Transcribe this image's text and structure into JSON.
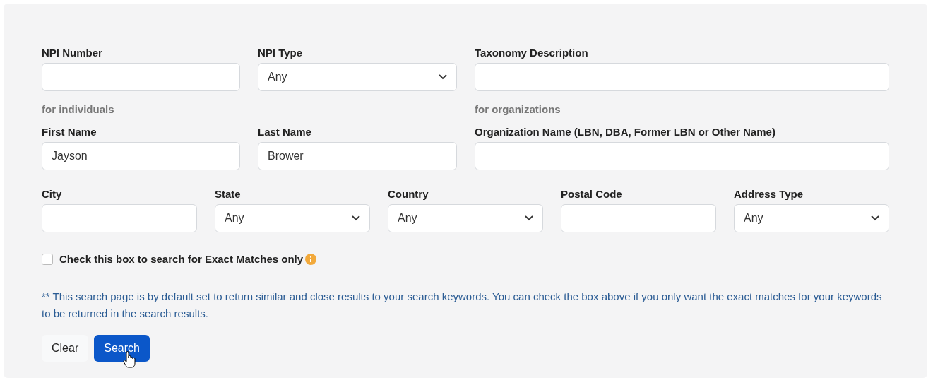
{
  "rows": [
    {
      "fields": [
        {
          "kind": "text",
          "label": "NPI Number"
        },
        {
          "kind": "select",
          "label": "NPI Type",
          "value": "Any"
        },
        {
          "kind": "text",
          "label": "Taxonomy Description"
        }
      ]
    },
    {
      "fields": [
        {
          "kind": "text",
          "caption": "for individuals",
          "label": "First Name",
          "value": "Jayson"
        },
        {
          "kind": "text",
          "label": "Last Name",
          "value": "Brower"
        },
        {
          "kind": "text",
          "caption": "for organizations",
          "label": "Organization Name (LBN, DBA, Former LBN or Other Name)"
        }
      ]
    },
    {
      "fields": [
        {
          "kind": "text",
          "label": "City"
        },
        {
          "kind": "select",
          "label": "State",
          "value": "Any"
        },
        {
          "kind": "select",
          "label": "Country",
          "value": "Any"
        },
        {
          "kind": "text",
          "label": "Postal Code"
        },
        {
          "kind": "select",
          "label": "Address Type",
          "value": "Any"
        }
      ]
    }
  ],
  "exact_match": {
    "label": "Check this box to search for Exact Matches only",
    "checked": false
  },
  "note": "** This search page is by default set to return similar and close results to your search keywords. You can check the box above if you only want the exact matches for your keywords to be returned in the search results.",
  "buttons": [
    {
      "kind": "secondary",
      "label": "Clear"
    },
    {
      "kind": "primary",
      "label": "Search"
    }
  ]
}
